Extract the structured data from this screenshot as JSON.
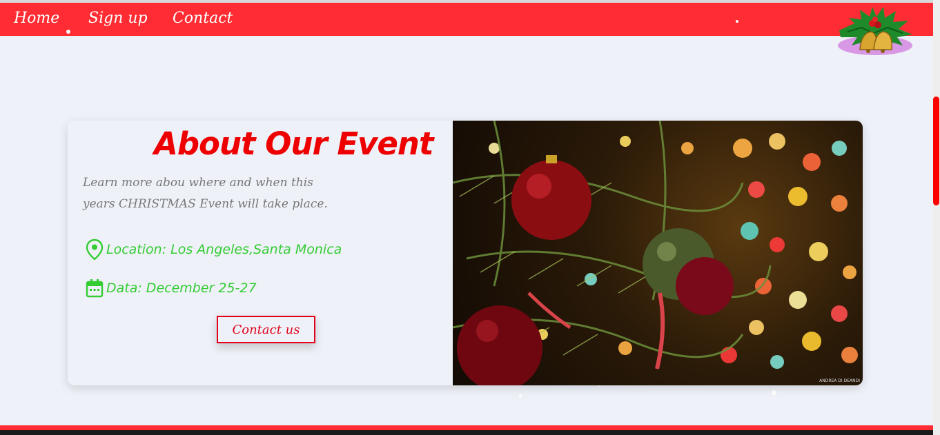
{
  "nav": {
    "links": [
      {
        "label": "Home"
      },
      {
        "label": "Sign up"
      },
      {
        "label": "Contact"
      }
    ]
  },
  "about": {
    "title": "About Our Event",
    "description": "Learn more abou where and when this years CHRISTMAS Event will take place.",
    "location": "Location: Los Angeles,Santa Monica",
    "date": "Data: December 25-27",
    "contact_label": "Contact us"
  },
  "photo": {
    "credit": "ANDREA DI DEANDI"
  },
  "colors": {
    "navbar": "#ff2d33",
    "title": "#ee0000",
    "info": "#33cc33",
    "background": "#eef1f8"
  },
  "icons": {
    "location": "map-pin-icon",
    "date": "calendar-icon",
    "ornament": "christmas-bells-icon"
  }
}
